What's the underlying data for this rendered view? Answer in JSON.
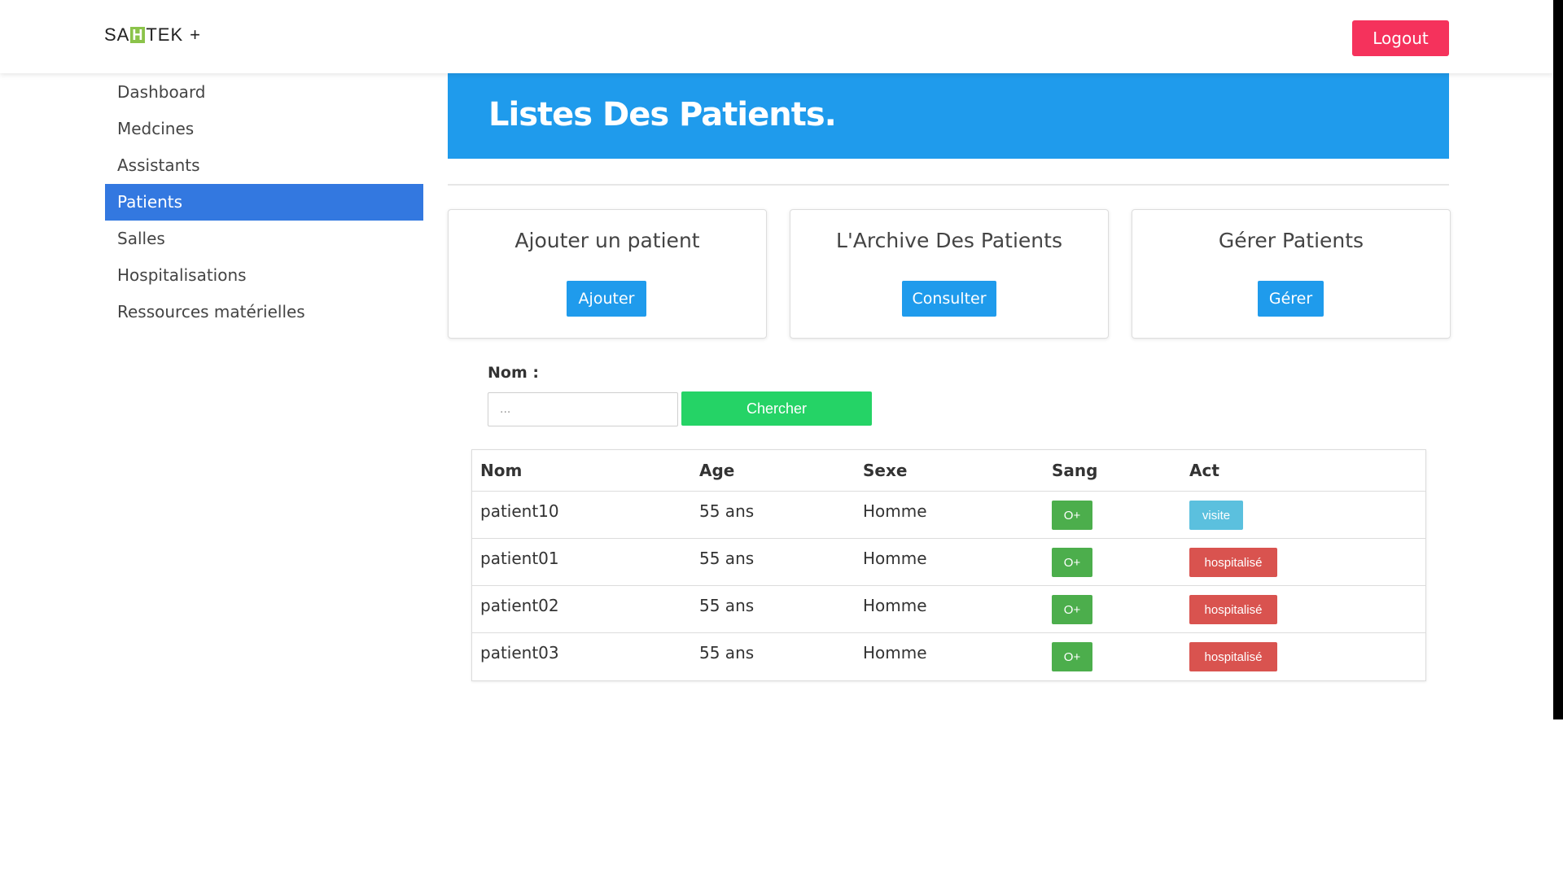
{
  "brand": {
    "left": "SA",
    "highlight": "H",
    "right": "TEK",
    "plus": "+"
  },
  "header": {
    "logout_label": "Logout"
  },
  "sidebar": {
    "items": [
      {
        "label": "Dashboard",
        "active": false
      },
      {
        "label": "Medcines",
        "active": false
      },
      {
        "label": "Assistants",
        "active": false
      },
      {
        "label": "Patients",
        "active": true
      },
      {
        "label": "Salles",
        "active": false
      },
      {
        "label": "Hospitalisations",
        "active": false
      },
      {
        "label": "Ressources matérielles",
        "active": false
      }
    ]
  },
  "main": {
    "title": "Listes Des Patients.",
    "cards": [
      {
        "title": "Ajouter un patient",
        "button": "Ajouter"
      },
      {
        "title": "L'Archive Des Patients",
        "button": "Consulter"
      },
      {
        "title": "Gérer Patients",
        "button": "Gérer"
      }
    ],
    "search": {
      "label": "Nom :",
      "placeholder": "...",
      "value": "",
      "button": "Chercher"
    },
    "table": {
      "headers": [
        "Nom",
        "Age",
        "Sexe",
        "Sang",
        "Act"
      ],
      "rows": [
        {
          "nom": "patient10",
          "age": "55 ans",
          "sexe": "Homme",
          "sang": "O+",
          "act": "visite",
          "act_type": "visite"
        },
        {
          "nom": "patient01",
          "age": "55 ans",
          "sexe": "Homme",
          "sang": "O+",
          "act": "hospitalisé",
          "act_type": "hospitalise"
        },
        {
          "nom": "patient02",
          "age": "55 ans",
          "sexe": "Homme",
          "sang": "O+",
          "act": "hospitalisé",
          "act_type": "hospitalise"
        },
        {
          "nom": "patient03",
          "age": "55 ans",
          "sexe": "Homme",
          "sang": "O+",
          "act": "hospitalisé",
          "act_type": "hospitalise"
        }
      ]
    }
  },
  "colors": {
    "banner": "#1f9bec",
    "logout": "#f5325c",
    "sidebar_active": "#3378e0",
    "search_button": "#25d366",
    "blood_tag": "#4cae4c",
    "visite_tag": "#5bc0de",
    "hospitalise_tag": "#d9534f",
    "brand_highlight": "#8bc34a"
  }
}
